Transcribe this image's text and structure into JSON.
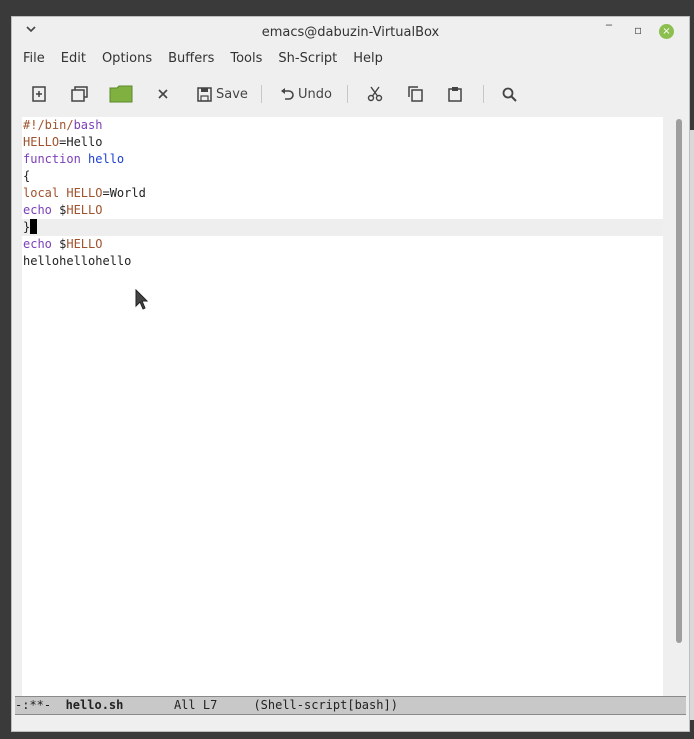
{
  "window": {
    "title": "emacs@dabuzin-VirtualBox",
    "controls": {
      "minimize": "‾",
      "restore": "▫",
      "close": "×"
    }
  },
  "menubar": [
    "File",
    "Edit",
    "Options",
    "Buffers",
    "Tools",
    "Sh-Script",
    "Help"
  ],
  "toolbar": {
    "save_label": "Save",
    "undo_label": "Undo",
    "icons": [
      "new-file-icon",
      "dired-icon",
      "open-folder-icon",
      "close-buffer-icon",
      "save-icon",
      "undo-icon",
      "cut-icon",
      "copy-icon",
      "paste-icon",
      "search-icon"
    ]
  },
  "editor": {
    "lines": [
      {
        "tokens": [
          {
            "t": "#!/bin/",
            "c": "var"
          },
          {
            "t": "bash",
            "c": "kw"
          }
        ]
      },
      {
        "tokens": [
          {
            "t": "HELLO",
            "c": "var"
          },
          {
            "t": "=Hello",
            "c": ""
          }
        ]
      },
      {
        "tokens": [
          {
            "t": "function",
            "c": "kw"
          },
          {
            "t": " ",
            "c": ""
          },
          {
            "t": "hello",
            "c": "fn"
          }
        ]
      },
      {
        "tokens": [
          {
            "t": "{",
            "c": ""
          }
        ]
      },
      {
        "tokens": [
          {
            "t": "local",
            "c": "var"
          },
          {
            "t": " ",
            "c": ""
          },
          {
            "t": "HELLO",
            "c": "var"
          },
          {
            "t": "=World",
            "c": ""
          }
        ]
      },
      {
        "tokens": [
          {
            "t": "echo",
            "c": "kw"
          },
          {
            "t": " $",
            "c": ""
          },
          {
            "t": "HELLO",
            "c": "var"
          }
        ]
      },
      {
        "tokens": [
          {
            "t": "}",
            "c": ""
          }
        ],
        "current": true
      },
      {
        "tokens": [
          {
            "t": "echo",
            "c": "kw"
          },
          {
            "t": " $",
            "c": ""
          },
          {
            "t": "HELLO",
            "c": "var"
          }
        ]
      },
      {
        "tokens": [
          {
            "t": "hellohellohello",
            "c": ""
          }
        ]
      }
    ]
  },
  "modeline": {
    "status": "-:**-",
    "buffer": "hello.sh",
    "position": "All L7",
    "mode": "(Shell-script[bash])"
  }
}
